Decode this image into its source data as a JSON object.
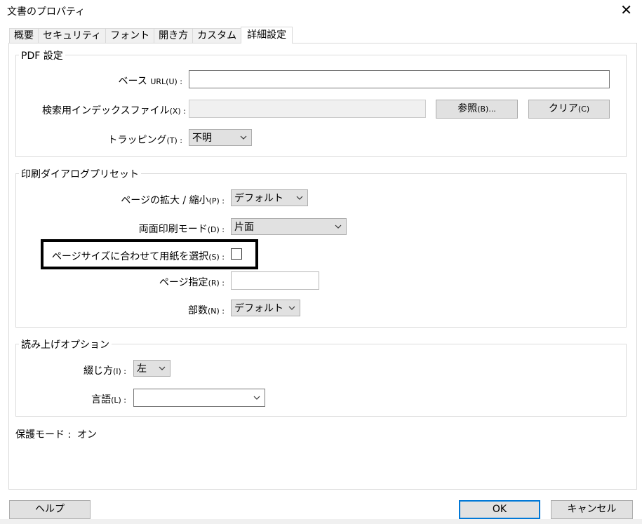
{
  "window": {
    "title": "文書のプロパティ",
    "close_glyph": "✕"
  },
  "tabs": [
    {
      "label": "概要"
    },
    {
      "label": "セキュリティ"
    },
    {
      "label": "フォント"
    },
    {
      "label": "開き方"
    },
    {
      "label": "カスタム"
    },
    {
      "label": "詳細設定",
      "active": true
    }
  ],
  "pdf_settings": {
    "legend": "PDF 設定",
    "base_url": {
      "label_main": "ベース ",
      "label_small": "URL(U) :",
      "value": ""
    },
    "search_index": {
      "label_main": "検索用インデックスファイル",
      "label_small": "(X) :",
      "value": ""
    },
    "browse_button": {
      "main": "参照",
      "small": "(B)..."
    },
    "clear_button": {
      "main": "クリア",
      "small": "(C)"
    },
    "trapping": {
      "label_main": "トラッピング",
      "label_small": "(T) :",
      "value": "不明"
    }
  },
  "print_presets": {
    "legend": "印刷ダイアログプリセット",
    "scaling": {
      "label_main": "ページの拡大 / 縮小",
      "label_small": "(P) :",
      "value": "デフォルト"
    },
    "duplex": {
      "label_main": "両面印刷モード",
      "label_small": "(D) :",
      "value": "片面"
    },
    "paper_by_page": {
      "label_main": "ページサイズに合わせて用紙を選択",
      "label_small": "(S) :",
      "checked": false
    },
    "page_range": {
      "label_main": "ページ指定",
      "label_small": "(R) :",
      "value": ""
    },
    "copies": {
      "label_main": "部数",
      "label_small": "(N) :",
      "value": "デフォルト"
    }
  },
  "read_aloud": {
    "legend": "読み上げオプション",
    "binding": {
      "label_main": "綴じ方",
      "label_small": "(I) :",
      "value": "左"
    },
    "language": {
      "label_main": "言語",
      "label_small": "(L) :",
      "value": ""
    }
  },
  "protected_mode": {
    "label": "保護モード :",
    "value": "オン"
  },
  "buttons": {
    "help": "ヘルプ",
    "ok": "OK",
    "cancel": "キャンセル"
  },
  "colors": {
    "default_button_border": "#0078d7",
    "button_bg": "#e1e1e1",
    "panel_border": "#d9d9d9"
  },
  "icons": {
    "dropdown": "chevron-down-icon",
    "close": "close-icon"
  }
}
